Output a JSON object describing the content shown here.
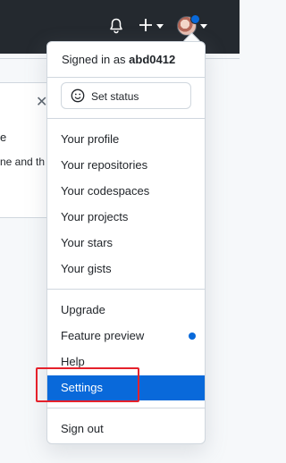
{
  "topbar": {
    "icons": [
      "bell-icon",
      "plus-icon",
      "chevron-down-icon",
      "avatar"
    ]
  },
  "background": {
    "close_glyph": "✕",
    "text1": "e",
    "text2": "ne and th"
  },
  "menu": {
    "signed_in_prefix": "Signed in as ",
    "username": "abd0412",
    "set_status": "Set status",
    "group1": [
      "Your profile",
      "Your repositories",
      "Your codespaces",
      "Your projects",
      "Your stars",
      "Your gists"
    ],
    "upgrade": "Upgrade",
    "feature_preview": "Feature preview",
    "help": "Help",
    "settings": "Settings",
    "sign_out": "Sign out"
  },
  "colors": {
    "topbar": "#24292f",
    "accent": "#0969da",
    "highlight_box": "#e5212b"
  }
}
